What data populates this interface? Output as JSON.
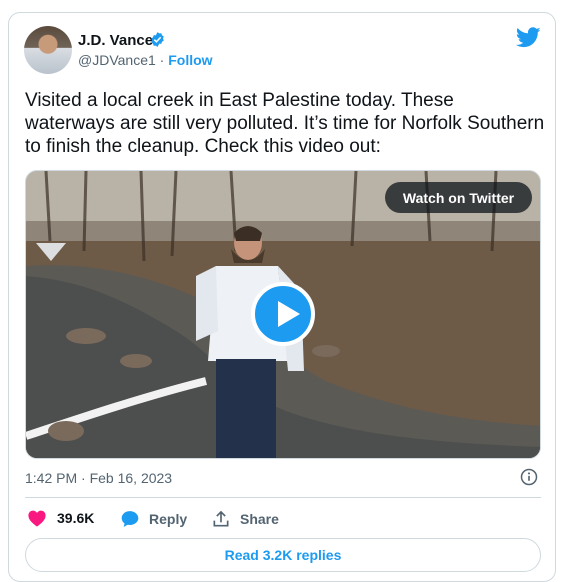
{
  "tweet": {
    "author_name": "J.D. Vance",
    "handle": "@JDVance1",
    "separator": "·",
    "follow_label": "Follow",
    "text": "Visited a local creek in East Palestine today. These waterways are still very polluted. It’s time for Norfolk Southern to finish the cleanup. Check this video out:",
    "timestamp": "1:42 PM · Feb 16, 2023",
    "likes": "39.6K",
    "reply_label": "Reply",
    "share_label": "Share",
    "read_replies_label": "Read 3.2K replies"
  },
  "media": {
    "watch_label": "Watch on Twitter"
  },
  "colors": {
    "brand": "#1d9bf0",
    "like": "#f91880",
    "text": "#0f1419",
    "muted": "#536471",
    "border": "#cfd9de"
  },
  "icons": {
    "logo": "twitter-bird-icon",
    "verified": "verified-badge-icon",
    "like": "heart-icon",
    "reply": "reply-bubble-icon",
    "share": "share-upload-icon",
    "info": "info-icon",
    "play": "play-icon"
  }
}
